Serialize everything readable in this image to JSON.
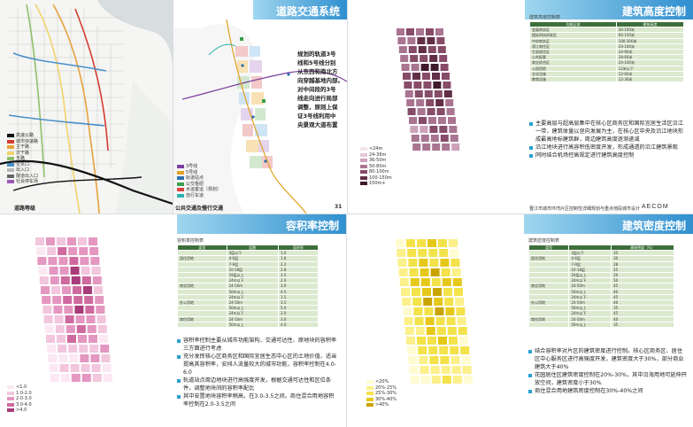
{
  "slide_road": {
    "label": "道路等级",
    "legend": [
      {
        "text": "高速公路",
        "color": "#111111"
      },
      {
        "text": "城市快速路",
        "color": "#d43c2e"
      },
      {
        "text": "主干路",
        "color": "#e6a23c"
      },
      {
        "text": "次干路",
        "color": "#f2d36b"
      },
      {
        "text": "支路",
        "color": "#8fbf6a"
      },
      {
        "text": "交叉口",
        "color": "#4a90c8"
      },
      {
        "text": "出入口",
        "color": "#b9b9b9"
      },
      {
        "text": "隧道出入口",
        "color": "#666666"
      },
      {
        "text": "社会停车场",
        "color": "#9b59b6"
      }
    ]
  },
  "slide_transit": {
    "title": "道路交通系统",
    "annotation": [
      "规划的轨道3号",
      "线和5号线分别",
      "从东西和南北方",
      "向穿越基地内部。",
      "对中间段的3号",
      "线走向进行局部",
      "调整，原则上保",
      "证3号线利用中",
      "央景观大道布置"
    ],
    "legend": [
      {
        "text": "3号线",
        "color": "#7b3fa0"
      },
      {
        "text": "5号线",
        "color": "#e0a020"
      },
      {
        "text": "轨道站点",
        "color": "#2a6fb0"
      },
      {
        "text": "公交枢纽",
        "color": "#3a9e4a"
      },
      {
        "text": "水运客运（规划）",
        "color": "#e04040"
      },
      {
        "text": "自行车道",
        "color": "#2bb0b0"
      }
    ],
    "label": "公共交通及慢行交通",
    "page_no": "31"
  },
  "slide_height": {
    "title": "建筑高度控制",
    "table_title": "建筑高度控制表",
    "table_headers": [
      "功能区域",
      "建筑高度"
    ],
    "table_rows": [
      [
        "会展商务区",
        "30-100米"
      ],
      [
        "国际科技研发区",
        "60-150米"
      ],
      [
        "中央商务区",
        "100-300米"
      ],
      [
        "滨江商住区",
        "24-100米"
      ],
      [
        "生态居住区",
        "24-60米"
      ],
      [
        "公共配套",
        "18-60米"
      ],
      [
        "商业综合区",
        "24-100米"
      ],
      [
        "公园用地",
        "12米以下"
      ],
      [
        "文化设施",
        "12-60米"
      ],
      [
        "教育设施",
        "12-30米"
      ]
    ],
    "legend": [
      {
        "text": "<24m",
        "color": "#f3e6ee"
      },
      {
        "text": "24-36m",
        "color": "#e4c9d8"
      },
      {
        "text": "36-50m",
        "color": "#cba2b9"
      },
      {
        "text": "50-80m",
        "color": "#a97590"
      },
      {
        "text": "80-100m",
        "color": "#864c68"
      },
      {
        "text": "100-150m",
        "color": "#622f47"
      },
      {
        "text": "150m+",
        "color": "#3f1a2c"
      }
    ],
    "bullets": [
      "主要高层与超高层集中在核心区商务区和国际宜居生活区沿江一带，建筑体量以竖向发展为主，在核心区中央及沿江地块形成最高地标建筑群，周边建筑高度逐渐递减",
      "沿江地块进行高容积低密度开发，形成通透的沿江建筑景观",
      "同时结合机场控高规定进行建筑高度控制"
    ],
    "ribbon_text": "晋江市城市环湾片区控制性详细规划与重点地段城市设计",
    "logo": "AECOM"
  },
  "slide_far": {
    "title": "容积率控制",
    "table_title": "容积率控制表",
    "table_headers": [
      "类型",
      "层数",
      "容积率"
    ],
    "table_rows": [
      [
        "",
        "3层以下",
        "1.0"
      ],
      [
        "居住用地",
        "4-6层",
        "1.8"
      ],
      [
        "",
        "7-9层",
        "2.2"
      ],
      [
        "",
        "10-18层",
        "2.8"
      ],
      [
        "",
        "19层以上",
        "3.5"
      ],
      [
        "",
        "24m以下",
        "2.0"
      ],
      [
        "商业用地",
        "24-50m",
        "3.0"
      ],
      [
        "",
        "50m以上",
        "4.5"
      ],
      [
        "",
        "24m以下",
        "1.5"
      ],
      [
        "办公用地",
        "24-50m",
        "3.5"
      ],
      [
        "",
        "50m以上",
        "5.0"
      ],
      [
        "",
        "24m以下",
        "2.0"
      ],
      [
        "商住用地",
        "24-50m",
        "3.0"
      ],
      [
        "",
        "50m以上",
        "4.0"
      ]
    ],
    "legend": [
      {
        "text": "<1.0",
        "color": "#fbe8f2"
      },
      {
        "text": "1.0-2.0",
        "color": "#f2c6dd"
      },
      {
        "text": "2.0-3.0",
        "color": "#e497c0"
      },
      {
        "text": "3.0-4.0",
        "color": "#cf6aa0"
      },
      {
        "text": ">4.0",
        "color": "#a83c7a"
      }
    ],
    "bullets": [
      "容积率控制主要从城市功能架构、交通可达性、原地块的容积率三方面进行考虑",
      "充分发挥核心区商务区和国际宜居生态中心区的土地价值，适当提高其容积率，安排人流量较大的城市功能，容积率控制在4.0-6.0",
      "轨道站点周边地块进行高强度开发，根据交通可达性和区位条件，调整地块间的容积率配比",
      "其中安置地块容积率稍高，在3.0-3.5之间。商住混合用地容积率控制在2.0-3.5之间"
    ]
  },
  "slide_density": {
    "title": "建筑密度控制",
    "table_title": "建筑密度控制表",
    "table_headers": [
      "类型",
      "",
      "建筑密度（%）"
    ],
    "table_rows": [
      [
        "",
        "3层以下",
        "35"
      ],
      [
        "居住用地",
        "4-6层",
        "30"
      ],
      [
        "",
        "7-9层",
        "28"
      ],
      [
        "",
        "10-18层",
        "25"
      ],
      [
        "",
        "19层以上",
        "20"
      ],
      [
        "",
        "24m以下",
        "50"
      ],
      [
        "商业用地",
        "24-50m",
        "45"
      ],
      [
        "",
        "50m以上",
        "40"
      ],
      [
        "",
        "24m以下",
        "45"
      ],
      [
        "办公用地",
        "24-50m",
        "40"
      ],
      [
        "",
        "50m以上",
        "35"
      ],
      [
        "",
        "24m以下",
        "45"
      ],
      [
        "商住用地",
        "24-50m",
        "40"
      ],
      [
        "",
        "50m以上",
        "35"
      ]
    ],
    "legend": [
      {
        "text": "<20%",
        "color": "#fffbd0"
      },
      {
        "text": "20%-25%",
        "color": "#fbf08a"
      },
      {
        "text": "25%-30%",
        "color": "#f3e24a"
      },
      {
        "text": "30%-40%",
        "color": "#e6c81a"
      },
      {
        "text": ">40%",
        "color": "#c9a400"
      }
    ],
    "bullets": [
      "结合容积率对片区的建筑密度进行控制。核心区商务区、居住区中心服务区进行高强度开发，建筑密度大于30%，部分商业建筑大于40%",
      "花园居住区建筑密度控制在20%-30%，其中沿海用地可延伸开放空间，建筑密度小于30%",
      "商住混合用地建筑密度控制在30%-40%之间"
    ]
  }
}
